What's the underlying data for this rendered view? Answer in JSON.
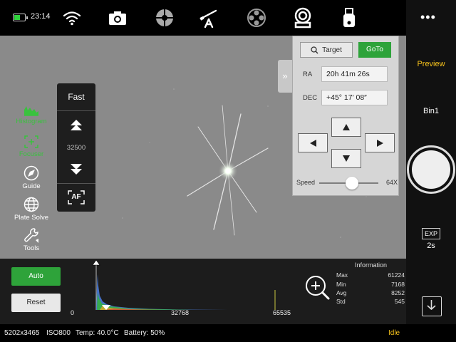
{
  "status_top": {
    "time": "23:14",
    "battery_level": 0.6
  },
  "top_icons": [
    "wifi-icon",
    "camera-icon",
    "filter-wheel-icon",
    "telescope-icon",
    "focuser-reel-icon",
    "guide-camera-icon",
    "usb-icon"
  ],
  "right_column": {
    "more": "•••",
    "preview": "Preview",
    "bin": "Bin1",
    "exp_label": "EXP",
    "exp_value": "2s"
  },
  "tools": {
    "histogram": "Histogram",
    "focuser": "Focuser",
    "guide": "Guide",
    "plate_solve": "Plate Solve",
    "tools": "Tools"
  },
  "speed_panel": {
    "mode": "Fast",
    "value": "32500",
    "af": "AF"
  },
  "goto_panel": {
    "target_label": "Target",
    "goto_label": "GoTo",
    "ra_label": "RA",
    "ra_value": "20h 41m 26s",
    "dec_label": "DEC",
    "dec_value": "+45° 17′ 08″",
    "speed_label": "Speed",
    "speed_value": "64X",
    "speed_fraction": 0.55
  },
  "histogram": {
    "auto_label": "Auto",
    "reset_label": "Reset",
    "axis": [
      "0",
      "32768",
      "65535"
    ]
  },
  "information": {
    "title": "Information",
    "rows": [
      {
        "label": "Max",
        "value": "61224"
      },
      {
        "label": "Min",
        "value": "7168"
      },
      {
        "label": "Avg",
        "value": "8252"
      },
      {
        "label": "Std",
        "value": "545"
      }
    ]
  },
  "status_bar": {
    "resolution": "5202x3465",
    "iso": "ISO800",
    "temp": "Temp: 40.0°C",
    "battery": "Battery: 50%",
    "state": "Idle"
  },
  "colors": {
    "accent_green": "#2ea33a",
    "accent_yellow": "#f6c21c",
    "tool_green": "#39c23e"
  }
}
